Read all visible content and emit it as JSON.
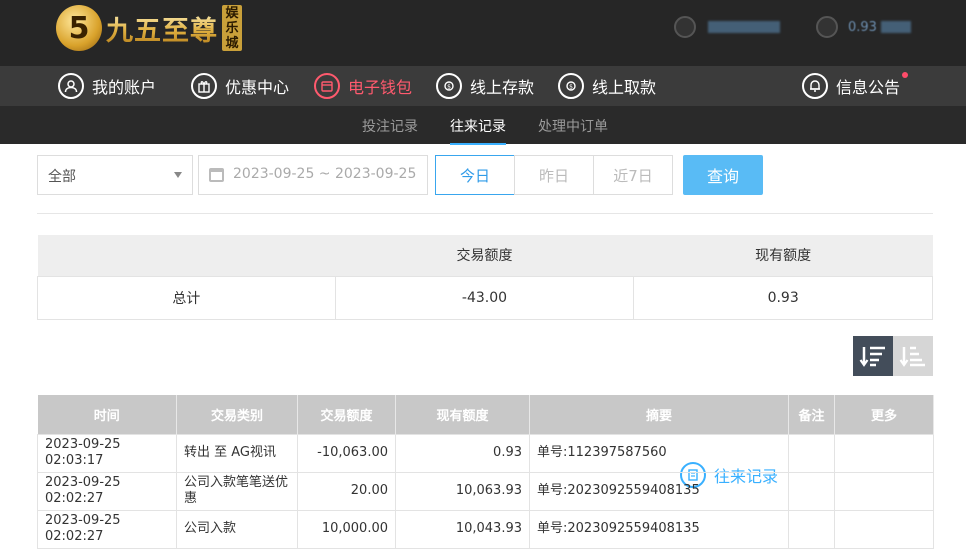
{
  "header": {
    "logo_char": "5",
    "logo_text": "九五至尊",
    "logo_badge": "娱乐城",
    "balance_partial": "0.93"
  },
  "nav": {
    "items": [
      {
        "label": "我的账户",
        "icon": "user-icon"
      },
      {
        "label": "优惠中心",
        "icon": "gift-icon"
      },
      {
        "label": "电子钱包",
        "icon": "wallet-icon"
      },
      {
        "label": "线上存款",
        "icon": "deposit-icon"
      },
      {
        "label": "线上取款",
        "icon": "withdraw-icon"
      },
      {
        "label": "往来记录",
        "icon": "records-icon"
      },
      {
        "label": "信息公告",
        "icon": "bell-icon"
      }
    ]
  },
  "subnav": {
    "items": [
      "投注记录",
      "往来记录",
      "处理中订单"
    ],
    "active": "往来记录"
  },
  "filter": {
    "type_value": "全部",
    "date_range": "2023-09-25 ~ 2023-09-25",
    "ranges": [
      "今日",
      "昨日",
      "近7日"
    ],
    "query_label": "查询"
  },
  "summary": {
    "headers": [
      "",
      "交易额度",
      "现有额度"
    ],
    "row": {
      "label": "总计",
      "amount": "-43.00",
      "balance": "0.93"
    }
  },
  "table": {
    "headers": [
      "时间",
      "交易类别",
      "交易额度",
      "现有额度",
      "摘要",
      "备注",
      "更多"
    ],
    "rows": [
      {
        "time": "2023-09-25 02:03:17",
        "category": "转出 至 AG视讯",
        "amount": "-10,063.00",
        "balance": "0.93",
        "summary": "单号:112397587560",
        "note": "",
        "more": ""
      },
      {
        "time": "2023-09-25 02:02:27",
        "category": "公司入款笔笔送优惠",
        "amount": "20.00",
        "balance": "10,063.93",
        "summary": "单号:2023092559408135",
        "note": "",
        "more": ""
      },
      {
        "time": "2023-09-25 02:02:27",
        "category": "公司入款",
        "amount": "10,000.00",
        "balance": "10,043.93",
        "summary": "单号:2023092559408135",
        "note": "",
        "more": ""
      }
    ]
  },
  "colors": {
    "accent": "#39b0ff",
    "wallet": "#ff5a6e",
    "query_button": "#59bbf5"
  }
}
